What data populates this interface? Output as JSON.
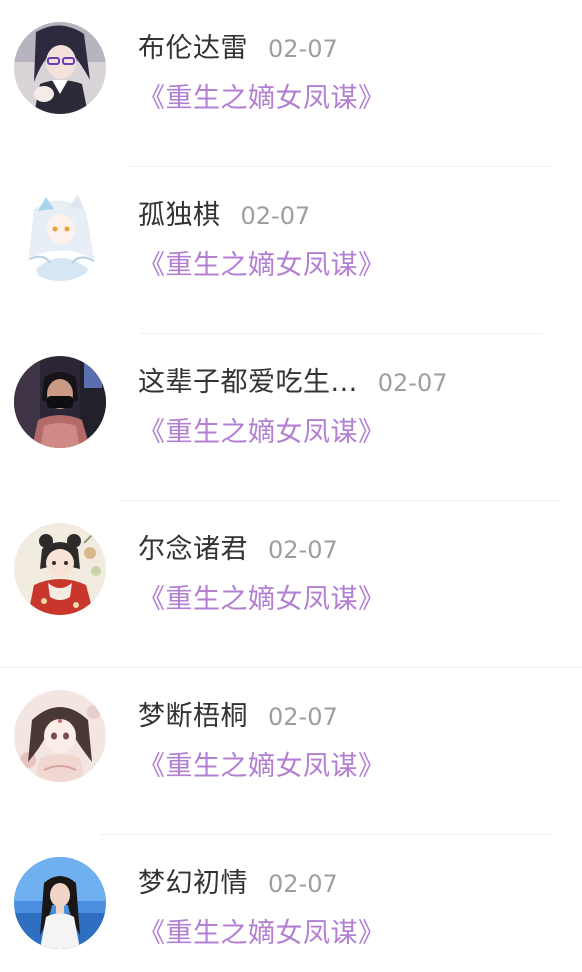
{
  "comments": [
    {
      "username": "布伦达雷",
      "date": "02-07",
      "book_title": "《重生之嫡女凤谋》",
      "avatar": "anime-girl-dark-hair-avatar"
    },
    {
      "username": "孤独棋",
      "date": "02-07",
      "book_title": "《重生之嫡女凤谋》",
      "avatar": "anime-white-hair-avatar"
    },
    {
      "username": "这辈子都爱吃生...",
      "date": "02-07",
      "book_title": "《重生之嫡女凤谋》",
      "avatar": "masked-person-avatar"
    },
    {
      "username": "尔念诸君",
      "date": "02-07",
      "book_title": "《重生之嫡女凤谋》",
      "avatar": "red-dress-girl-avatar"
    },
    {
      "username": "梦断梧桐",
      "date": "02-07",
      "book_title": "《重生之嫡女凤谋》",
      "avatar": "anime-girl-pink-avatar"
    },
    {
      "username": "梦幻初情",
      "date": "02-07",
      "book_title": "《重生之嫡女凤谋》",
      "avatar": "girl-photo-blue-sky-avatar"
    }
  ],
  "colors": {
    "username": "#333333",
    "date": "#9e9e9e",
    "book_title": "#b37fd3",
    "divider": "#efefef"
  }
}
